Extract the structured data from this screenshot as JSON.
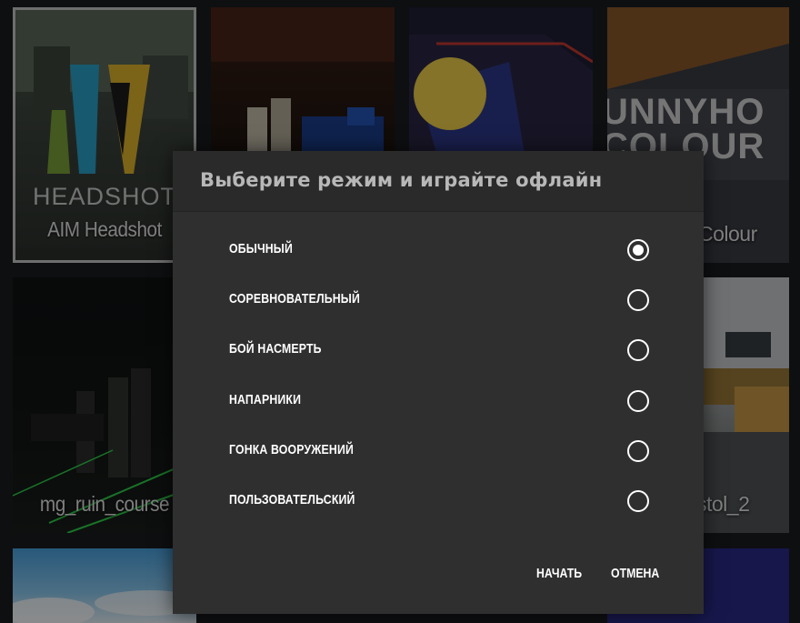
{
  "maps": [
    {
      "label": "AIM Headshot",
      "logo_text": "HEADSHOT"
    },
    {
      "label": ""
    },
    {
      "label": ""
    },
    {
      "label": "Colour",
      "logo_text": "UNNYHO COLOUR"
    },
    {
      "label": "mg_ruin_course"
    },
    {
      "label": "stol_2"
    },
    {
      "label": ""
    },
    {
      "label": ""
    }
  ],
  "dialog": {
    "title": "Выберите режим и играйте офлайн",
    "options": [
      {
        "label": "ОБЫЧНЫЙ",
        "selected": true
      },
      {
        "label": "СОРЕВНОВАТЕЛЬНЫЙ",
        "selected": false
      },
      {
        "label": "БОЙ НАСМЕРТЬ",
        "selected": false
      },
      {
        "label": "НАПАРНИКИ",
        "selected": false
      },
      {
        "label": "ГОНКА ВООРУЖЕНИЙ",
        "selected": false
      },
      {
        "label": "ПОЛЬЗОВАТЕЛЬСКИЙ",
        "selected": false
      }
    ],
    "start_label": "НАЧАТЬ",
    "cancel_label": "ОТМЕНА"
  },
  "colors": {
    "background": "#1b1d20",
    "dialog_bg": "#2f2f2f",
    "header_bg": "#2a2a2a",
    "text": "#ffffff",
    "title_text": "#b8b8b8"
  }
}
